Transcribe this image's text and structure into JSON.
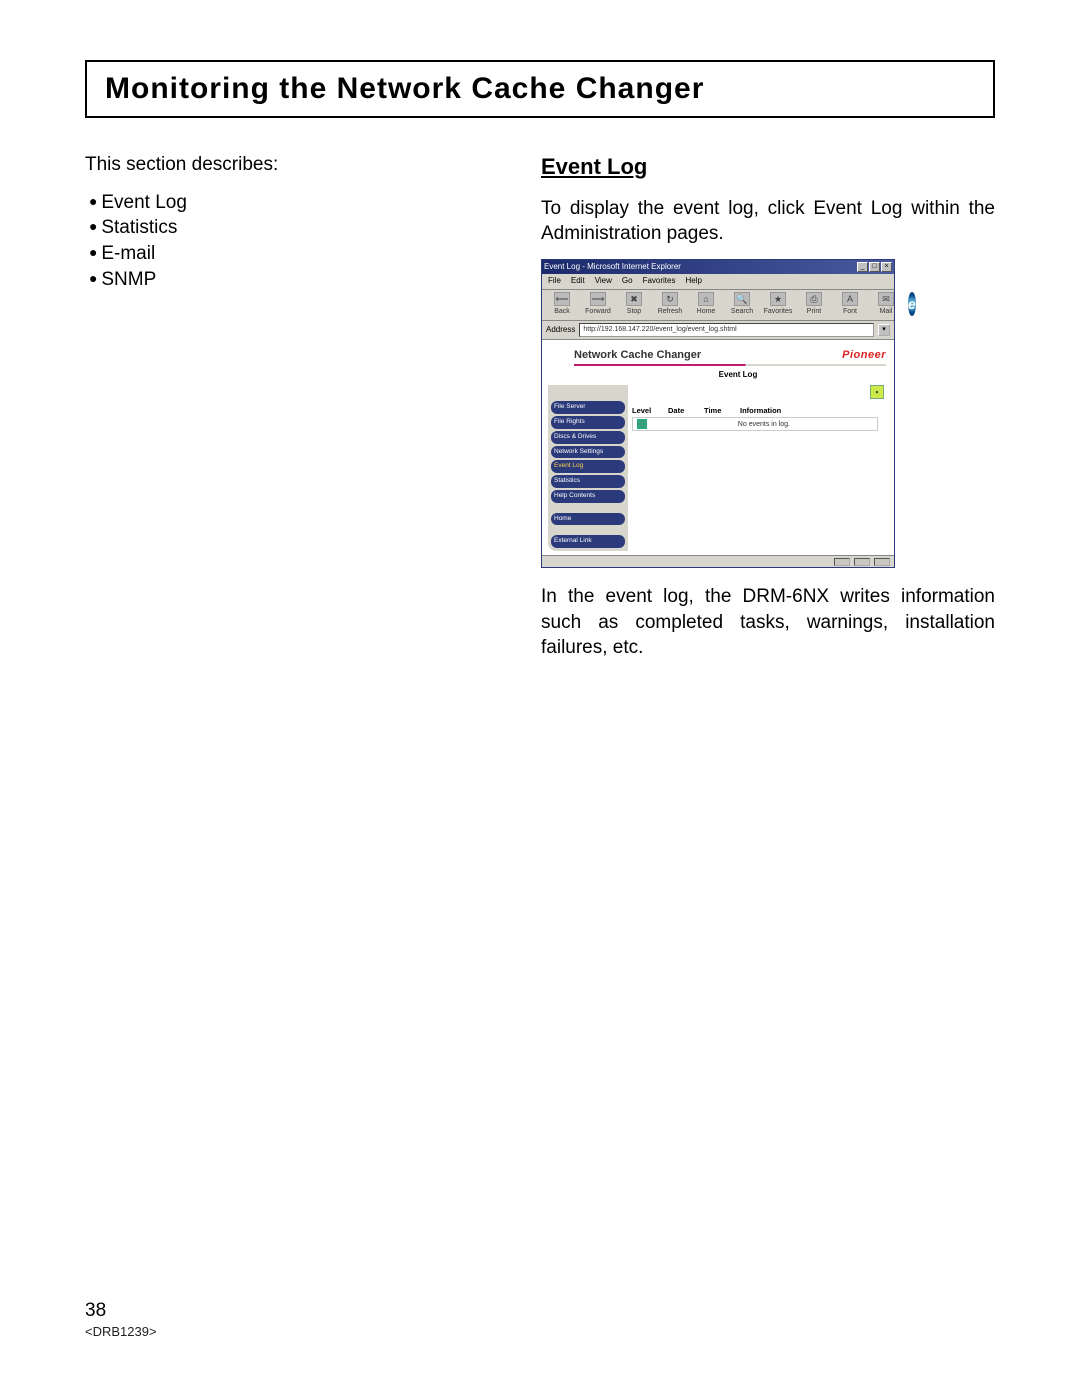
{
  "title": "Monitoring the Network Cache Changer",
  "left": {
    "intro": "This section describes:",
    "bullets": [
      "Event Log",
      "Statistics",
      "E-mail",
      "SNMP"
    ]
  },
  "right": {
    "heading": "Event Log",
    "para1": "To display the event log, click Event Log within the Administration pages.",
    "para2": "In the event log, the DRM-6NX writes information such as completed tasks, warnings, installation failures, etc."
  },
  "screenshot": {
    "window_title": "Event Log - Microsoft Internet Explorer",
    "menus": [
      "File",
      "Edit",
      "View",
      "Go",
      "Favorites",
      "Help"
    ],
    "toolbar": [
      {
        "label": "Back",
        "glyph": "⟵"
      },
      {
        "label": "Forward",
        "glyph": "⟶"
      },
      {
        "label": "Stop",
        "glyph": "✖"
      },
      {
        "label": "Refresh",
        "glyph": "↻"
      },
      {
        "label": "Home",
        "glyph": "⌂"
      },
      {
        "label": "Search",
        "glyph": "🔍"
      },
      {
        "label": "Favorites",
        "glyph": "★"
      },
      {
        "label": "Print",
        "glyph": "⎙"
      },
      {
        "label": "Font",
        "glyph": "A"
      },
      {
        "label": "Mail",
        "glyph": "✉"
      }
    ],
    "address_label": "Address",
    "address_value": "http://192.168.147.220/event_log/event_log.shtml",
    "header_title": "Network Cache Changer",
    "brand": "Pioneer",
    "page_title": "Event Log",
    "sidebar": [
      {
        "label": "File Server",
        "active": false
      },
      {
        "label": "File Rights",
        "active": false
      },
      {
        "label": "Discs & Drives",
        "active": false
      },
      {
        "label": "Network Settings",
        "active": false
      },
      {
        "label": "Event Log",
        "active": true
      },
      {
        "label": "Statistics",
        "active": false
      },
      {
        "label": "Help Contents",
        "active": false
      }
    ],
    "sidebar2": [
      {
        "label": "Home",
        "active": false
      }
    ],
    "sidebar3": [
      {
        "label": "External Link",
        "active": false
      }
    ],
    "table": {
      "headers": [
        "Level",
        "Date",
        "Time",
        "Information"
      ],
      "empty_msg": "No events in log."
    },
    "win_buttons": [
      "_",
      "□",
      "×"
    ]
  },
  "footer": {
    "page": "38",
    "docid": "<DRB1239>"
  }
}
